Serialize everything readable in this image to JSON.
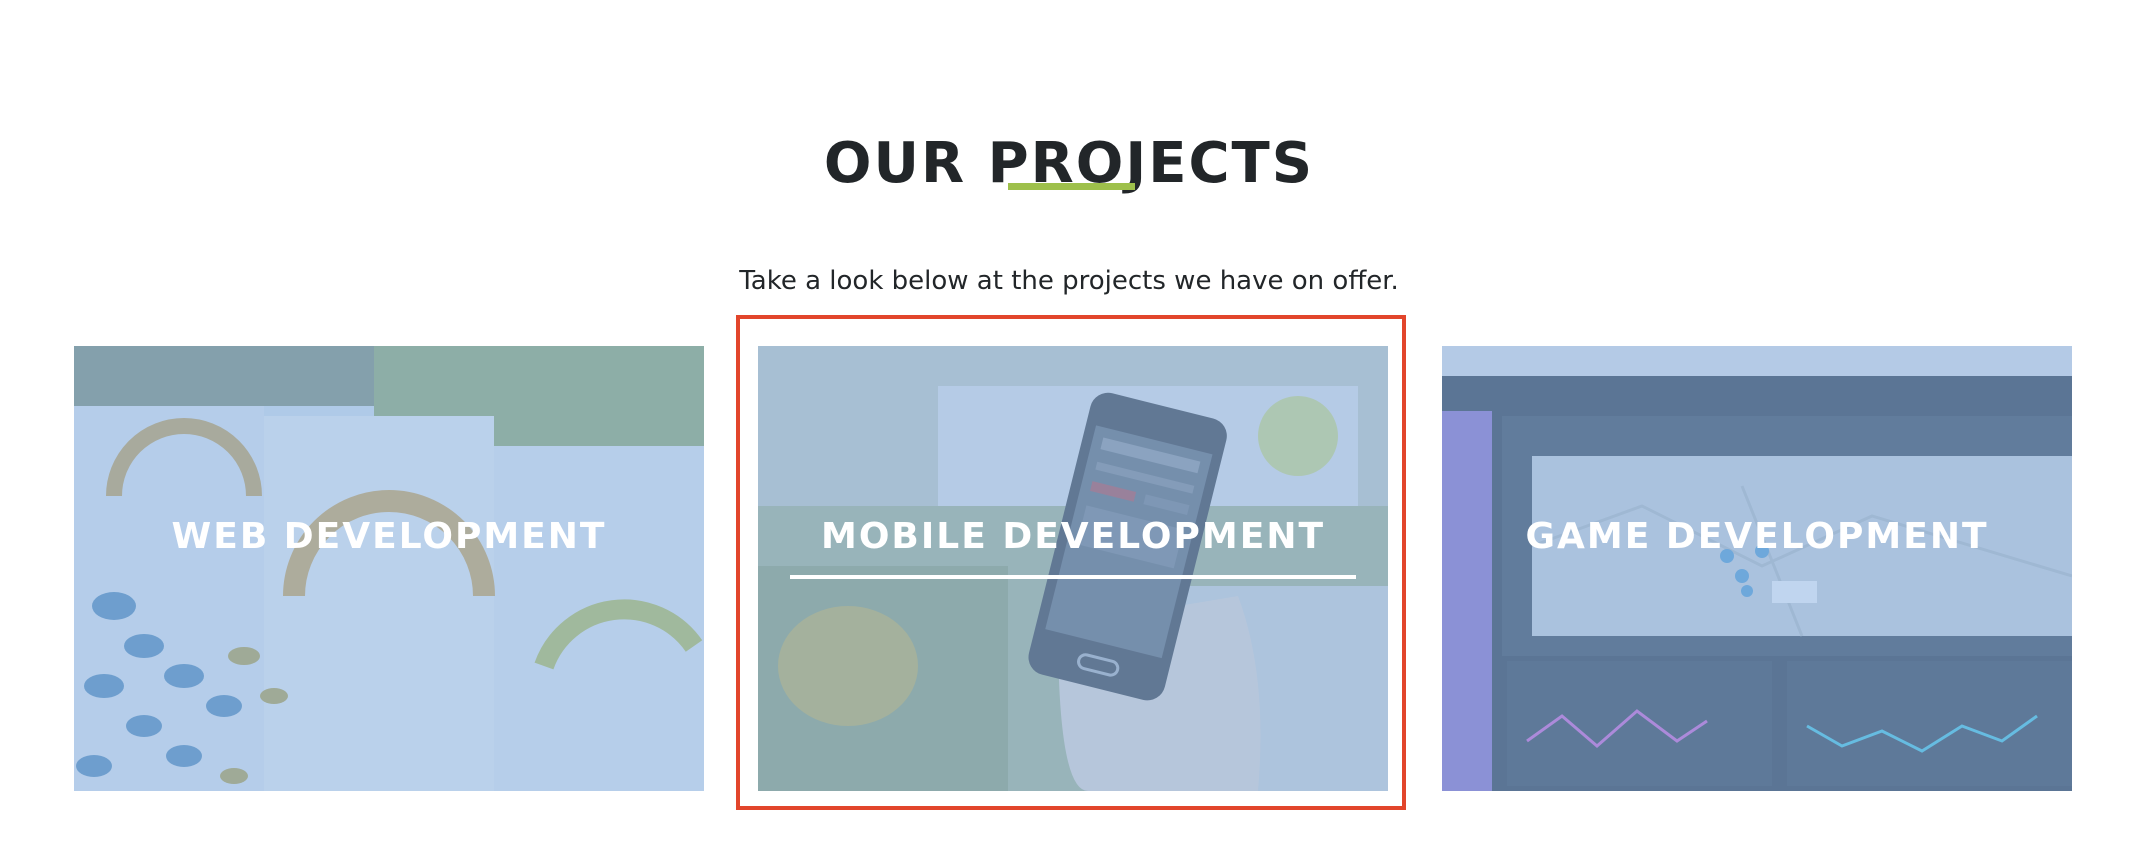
{
  "section": {
    "title": "OUR PROJECTS",
    "subtitle": "Take a look below at the projects we have on offer.",
    "accent_color": "#9ec04b"
  },
  "projects": [
    {
      "label": "WEB DEVELOPMENT",
      "image": "dashboard-gauges-photo"
    },
    {
      "label": "MOBILE DEVELOPMENT",
      "image": "hand-holding-phone-photo",
      "hovered": true
    },
    {
      "label": "GAME DEVELOPMENT",
      "image": "map-dashboard-screen-photo"
    }
  ],
  "highlight_color": "#e2452b"
}
